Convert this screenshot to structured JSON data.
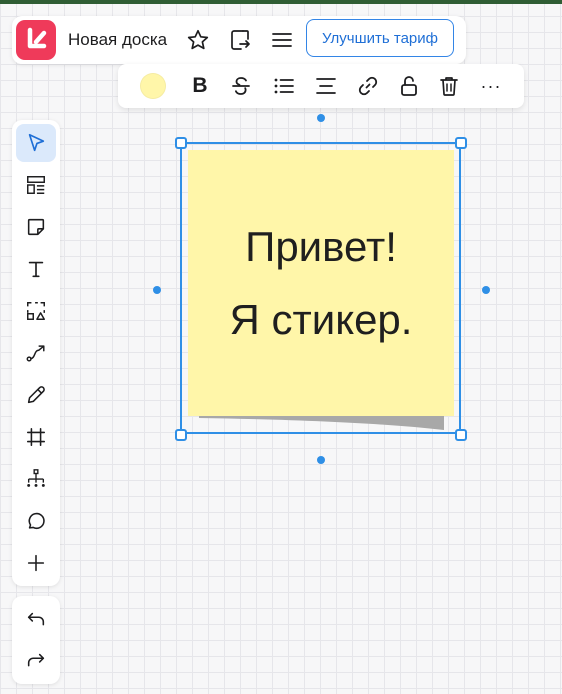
{
  "header": {
    "board_title": "Новая доска",
    "upgrade_label": "Улучшить тариф"
  },
  "context_toolbar": {
    "sticker_color": "#fff6a9",
    "bold_label": "B",
    "more_label": "···",
    "items": [
      "color-picker",
      "bold",
      "strikethrough",
      "bullet-list",
      "align",
      "link",
      "lock",
      "delete",
      "more"
    ]
  },
  "left_toolbar": {
    "tools": [
      "select",
      "templates",
      "sticker",
      "text",
      "shapes",
      "connector",
      "pen",
      "frame",
      "mindmap",
      "comment",
      "add"
    ],
    "active_tool": "select",
    "history": [
      "undo",
      "redo"
    ]
  },
  "sticker": {
    "line1": "Привет!",
    "line2": "Я стикер.",
    "color": "#fff6a9"
  },
  "colors": {
    "accent": "#2f8fe6",
    "brand": "#ef3a5a",
    "active_tool_bg": "#dbe9fb"
  }
}
